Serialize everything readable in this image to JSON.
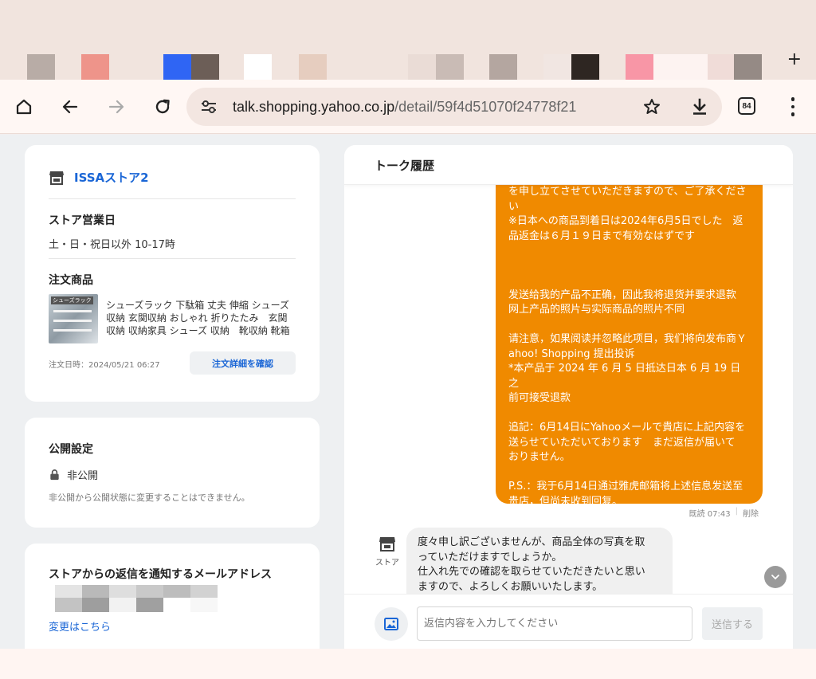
{
  "browser": {
    "url_host": "talk.shopping.yahoo.co.jp",
    "url_path": "/detail/59f4d51070f24778f21",
    "tab_count": "84"
  },
  "left": {
    "store_name": "ISSAストア2",
    "hours_label": "ストア営業日",
    "hours_value": "土・日・祝日以外 10-17時",
    "product_label": "注文商品",
    "thumb_label": "シューズラック",
    "product_name": "シューズラック 下駄箱 丈夫 伸縮 シューズ収納 玄関収納 おしゃれ 折りたたみ　玄関収納 収納家具 シューズ 収納　靴収納 靴箱 靴入れ",
    "order_date": "注文日時：2024/05/21 06:27",
    "detail_button": "注文詳細を確認",
    "privacy_label": "公開設定",
    "privacy_value": "非公開",
    "privacy_note": "非公開から公開状態に変更することはできません。",
    "email_label": "ストアからの返信を通知するメールアドレス",
    "change_link": "変更はこちら"
  },
  "chat": {
    "title": "トーク履歴",
    "outgoing": "を申し立てさせていただきますので、ご了承くださ\nい\n※日本への商品到着日は2024年6月5日でした　返\n品返金は６月１９日まで有効なはずです\n\n\n\n发送给我的产品不正确，因此我将退货并要求退款\n网上产品的照片与实际商品的照片不同\n\n请注意，如果阅读并忽略此项目，我们将向发布商Ｙ\nahoo! Shopping 提出投诉\n*本产品于 2024 年 6 月 5 日抵达日本 6 月 19 日之\n前可接受退款\n\n追記：6月14日にYahooメールで貴店に上記内容を\n送らせていただいております　まだ返信が届いて\nおりません。\n\nP.S.：我于6月14日通过雅虎邮箱将上述信息发送至\n贵店，但尚未收到回复。",
    "read_time": "既読 07:43",
    "delete": "削除",
    "store_label": "ストア",
    "incoming": "度々申し訳ございませんが、商品全体の写真を取\nっていただけますでしょうか。\n仕入れ先での確認を取らせていただきたいと思い\nますので、よろしくお願いいたします。",
    "input_placeholder": "返信内容を入力してください",
    "send_button": "送信する"
  },
  "colors": {
    "accent_blue": "#1a66d6",
    "bubble_orange": "#f08a00"
  }
}
